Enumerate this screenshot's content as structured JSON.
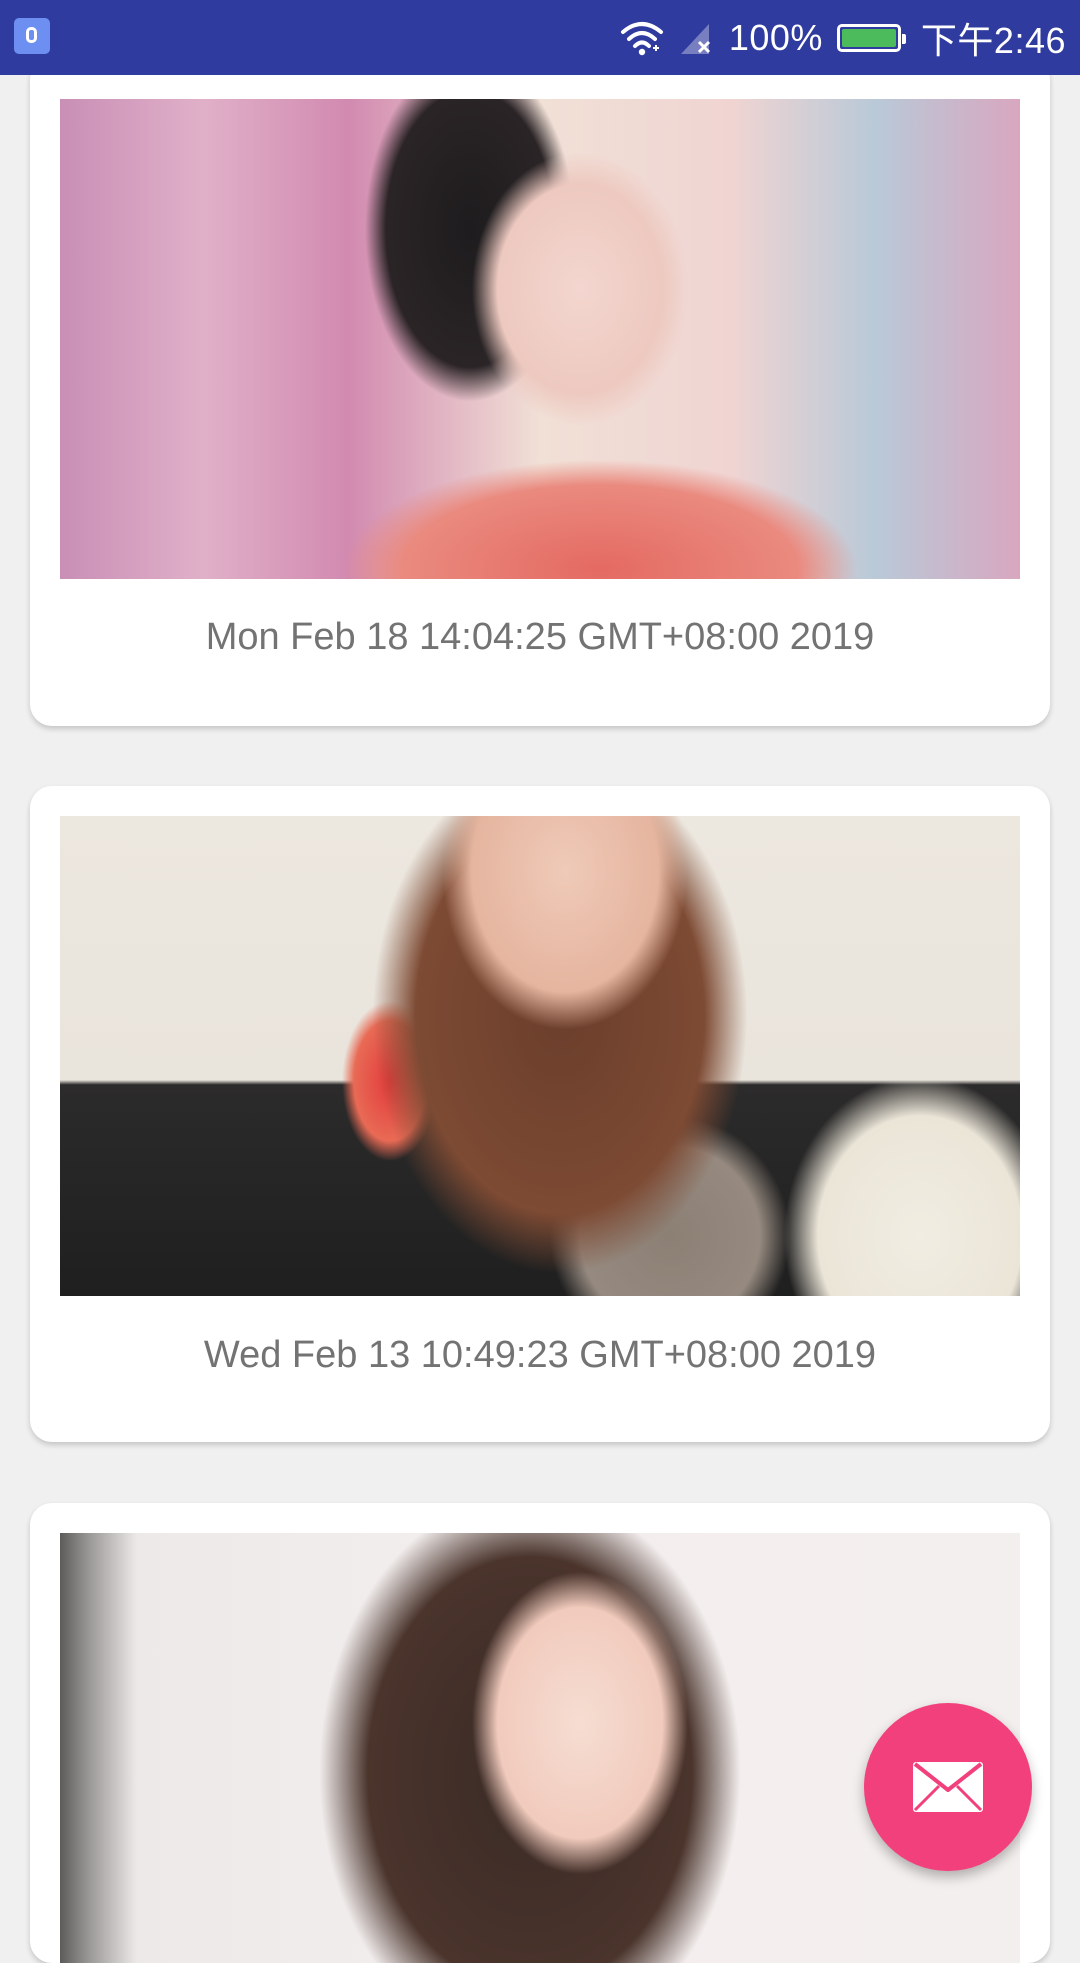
{
  "status_bar": {
    "battery_percent": "100%",
    "time": "下午2:46",
    "icons": [
      "notification-icon",
      "wifi-icon",
      "signal-no-service-icon",
      "battery-icon"
    ]
  },
  "feed": {
    "items": [
      {
        "photo": "photo-woman-in-kimono",
        "caption": "Mon Feb 18 14:04:25 GMT+08:00 2019"
      },
      {
        "photo": "photo-woman-with-red-drink",
        "caption": "Wed Feb 13 10:49:23 GMT+08:00 2019"
      },
      {
        "photo": "photo-smiling-woman",
        "caption": ""
      }
    ]
  },
  "fab": {
    "icon": "email-icon",
    "color": "#f2407d"
  },
  "colors": {
    "status_bar": "#2f3b9f",
    "background": "#f1f0f1",
    "card": "#ffffff",
    "caption_text": "#737373"
  }
}
